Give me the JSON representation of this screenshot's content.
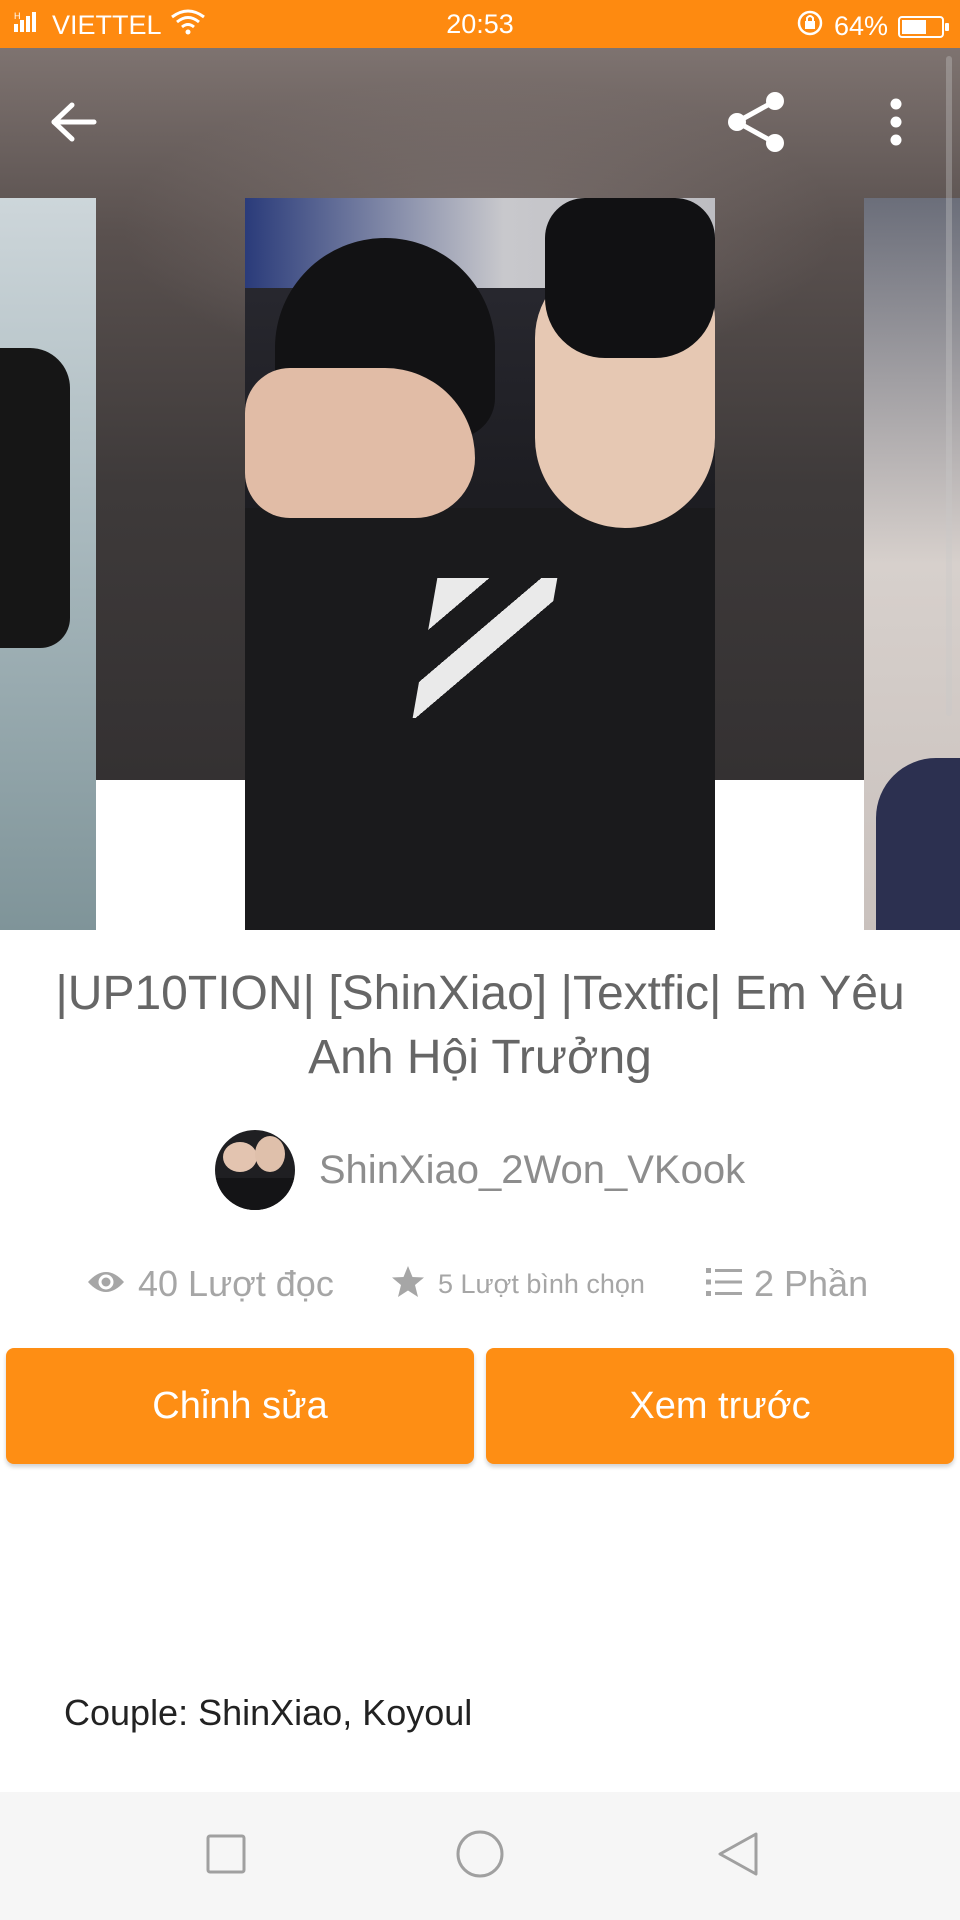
{
  "status_bar": {
    "carrier": "VIETTEL",
    "time": "20:53",
    "battery_percent": "64%",
    "battery_level": 0.64,
    "icons": [
      "signal-icon",
      "wifi-icon",
      "rotation-lock-icon",
      "battery-icon"
    ]
  },
  "app_bar": {
    "icons": [
      "back-arrow-icon",
      "share-icon",
      "more-vert-icon"
    ]
  },
  "story": {
    "title": "|UP10TION| [ShinXiao] |Textfic| Em Yêu Anh Hội Trưởng",
    "author": "ShinXiao_2Won_VKook",
    "stats": {
      "reads": "40 Lượt đọc",
      "votes": "5 Lượt bình chọn",
      "parts": "2 Phần"
    },
    "description": "Couple: ShinXiao, Koyoul"
  },
  "actions": {
    "edit_label": "Chỉnh sửa",
    "preview_label": "Xem trước"
  },
  "nav_bar": {
    "icons": [
      "recents-square-icon",
      "home-circle-icon",
      "back-triangle-icon"
    ]
  },
  "colors": {
    "accent": "#fe8a10",
    "button": "#fe8e14",
    "secondary_text": "#a6a6a6",
    "title_text": "#666666"
  }
}
